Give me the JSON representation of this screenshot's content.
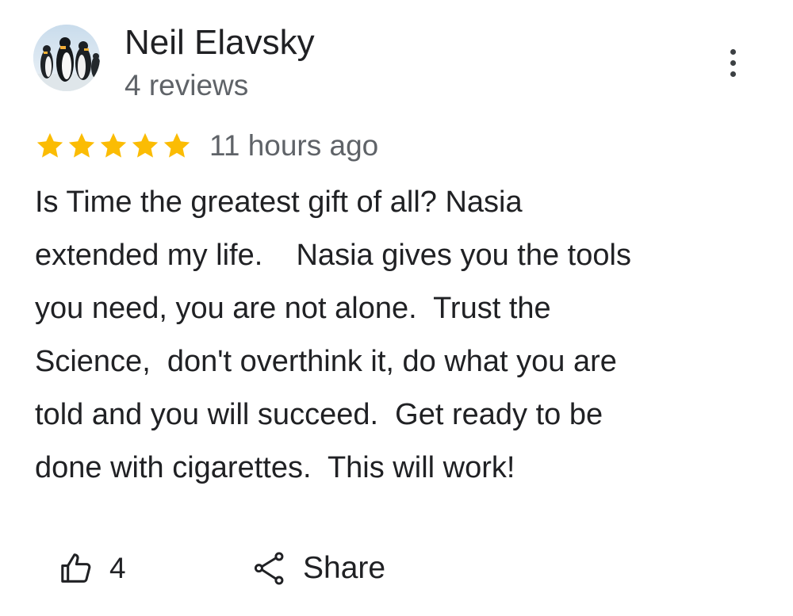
{
  "reviewer": {
    "name": "Neil Elavsky",
    "review_count": "4 reviews",
    "avatar_icon": "penguins-photo-avatar"
  },
  "rating": {
    "stars": 5,
    "max_stars": 5,
    "star_color": "#fbbc04",
    "time": "11 hours ago"
  },
  "review": {
    "lines": [
      "Is Time the greatest gift of all? Nasia",
      "extended my life.    Nasia gives you the tools",
      "you need, you are not alone.  Trust the",
      "Science,  don't overthink it, do what you are",
      "told and you will succeed.  Get ready to be",
      "done with cigarettes.  This will work!"
    ]
  },
  "actions": {
    "like_icon": "thumbs-up-icon",
    "like_count": "4",
    "share_icon": "share-icon",
    "share_label": "Share",
    "more_icon": "more-vert-icon"
  },
  "colors": {
    "text_primary": "#202124",
    "text_secondary": "#5f6368"
  }
}
